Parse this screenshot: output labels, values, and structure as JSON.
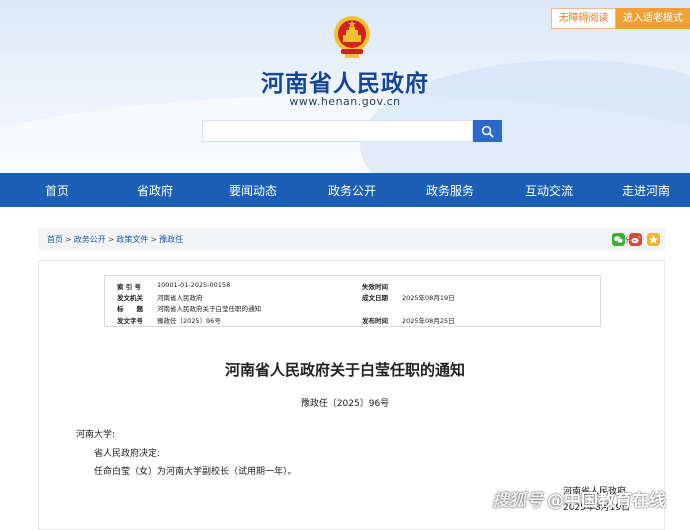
{
  "top_buttons": {
    "accessibility": "无障碍阅读",
    "elder_mode": "进入适老模式"
  },
  "site": {
    "title": "河南省人民政府",
    "url": "www.henan.gov.cn"
  },
  "search": {
    "placeholder": ""
  },
  "nav": [
    "首页",
    "省政府",
    "要闻动态",
    "政务公开",
    "政务服务",
    "互动交流",
    "走进河南"
  ],
  "breadcrumb": {
    "items": [
      "首页",
      "政务公开",
      "政策文件",
      "豫政任"
    ],
    "separator": ">"
  },
  "share": {
    "label": "分享:"
  },
  "meta": {
    "index_label": "索 引 号",
    "index_value": "10001-01-2025-00158",
    "invalid_label": "失效时间",
    "invalid_value": "",
    "issuer_label": "发文机关",
    "issuer_value": "河南省人民政府",
    "date_label": "成文日期",
    "date_value": "2025年08月19日",
    "title_label": "标　　题",
    "title_value": "河南省人民政府关于白莹任职的通知",
    "docno_label": "发文字号",
    "docno_value": "豫政任〔2025〕96号",
    "pub_label": "发布时间",
    "pub_value": "2025年08月25日"
  },
  "document": {
    "title": "河南省人民政府关于白莹任职的通知",
    "number": "豫政任〔2025〕96号",
    "recipient": "河南大学:",
    "line1": "省人民政府决定:",
    "line2": "任命白莹（女）为河南大学副校长（试用期一年）。",
    "signer": "河南省人民政府",
    "sign_date": "2025年8月19日"
  },
  "watermark": {
    "brand": "搜狐号",
    "text": "@中国教育在线"
  },
  "colors": {
    "nav_bg": "#1a5fb4",
    "title": "#15469a",
    "elder_btn": "#eea235",
    "a11y_text": "#e8732b"
  }
}
